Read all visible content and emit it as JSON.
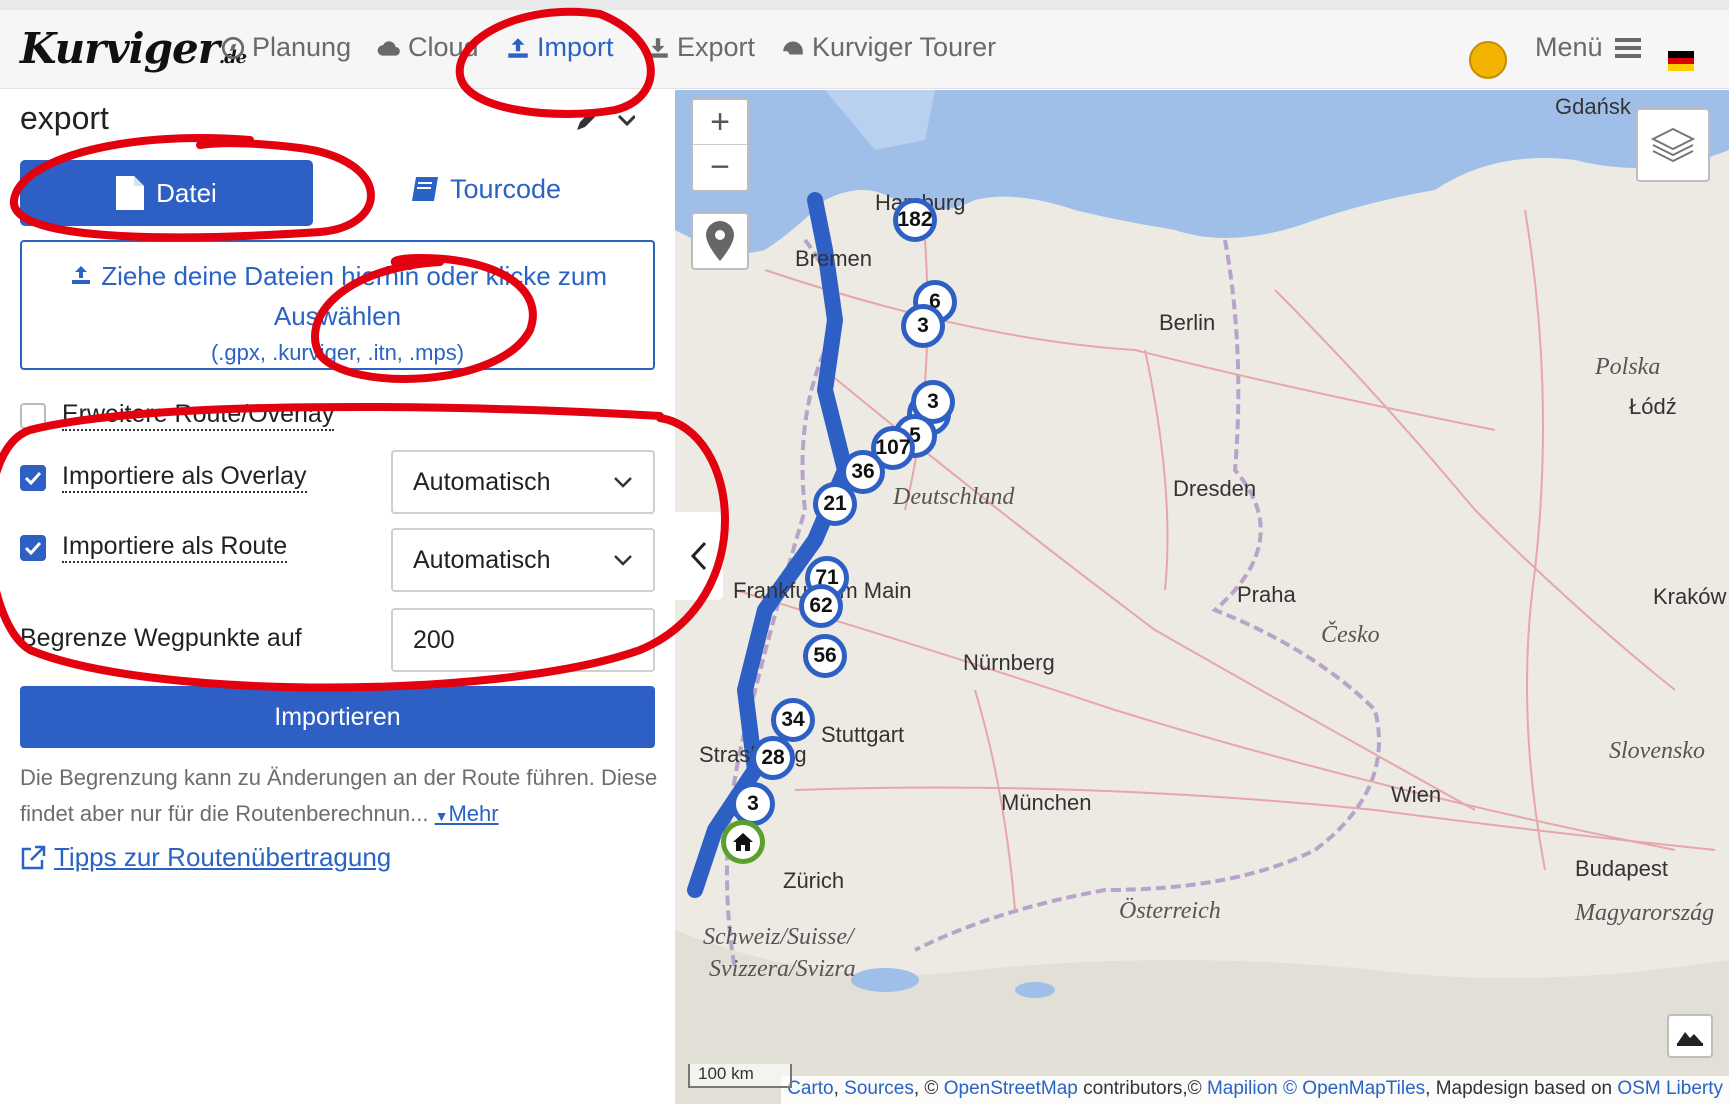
{
  "brand": {
    "name": "Kurviger",
    "suffix": ".de"
  },
  "nav": {
    "planung": "Planung",
    "cloud": "Cloud",
    "import": "Import",
    "export": "Export",
    "tourer": "Kurviger Tourer",
    "menu": "Menü"
  },
  "panel": {
    "title": "export",
    "tab_file": "Datei",
    "tab_tourcode": "Tourcode",
    "dropzone_text": "Ziehe deine Dateien hierhin oder klicke zum Auswählen",
    "dropzone_formats": "(.gpx, .kurviger, .itn, .mps)",
    "extended_route": "Erweitere Route/Overlay",
    "import_overlay": "Importiere als Overlay",
    "import_route": "Importiere als Route",
    "select_overlay_value": "Automatisch",
    "select_route_value": "Automatisch",
    "limit_label": "Begrenze Wegpunkte auf",
    "limit_value": "200",
    "import_button": "Importieren",
    "hint_text": "Die Begrenzung kann zu Änderungen an der Route führen. Diese findet aber nur für die Routenberechnun...",
    "more_link": "Mehr",
    "tips_link": "Tipps zur Routenübertragung"
  },
  "map": {
    "cities": {
      "gdansk": "Gdańsk",
      "hamburg": "Hamburg",
      "bremen": "Bremen",
      "berlin": "Berlin",
      "polska": "Polska",
      "lodz": "Łódź",
      "dresden": "Dresden",
      "deutschland": "Deutschland",
      "frankfurt": "Frankfurt am Main",
      "praha": "Praha",
      "krakow": "Kraków",
      "cesko": "Česko",
      "nurnberg": "Nürnberg",
      "stuttgart": "Stuttgart",
      "strasbourg": "Strasbourg",
      "slovensko": "Slovensko",
      "munchen": "München",
      "wien": "Wien",
      "zurich": "Zürich",
      "budapest": "Budapest",
      "osterreich": "Österreich",
      "magyarorszag": "Magyarország",
      "schweiz": "Schweiz/Suisse/",
      "svizzera": "Svizzera/Svizra"
    },
    "markers": [
      "182",
      "6",
      "3",
      "19",
      "5",
      "107",
      "36",
      "21",
      "71",
      "62",
      "56",
      "34",
      "28",
      "3"
    ],
    "scale": "100 km",
    "attribution": {
      "carto": "Carto",
      "sources": "Sources",
      "osm_prefix": ", © ",
      "osm": "OpenStreetMap",
      "contributors": " contributors,© ",
      "mapilion": "Mapilion",
      "sep": " © ",
      "omt": "OpenMapTiles",
      "design": ", Mapdesign based on ",
      "liberty": "OSM Liberty"
    }
  },
  "colors": {
    "accent": "#2d5fc5",
    "annotation": "#e3000f"
  }
}
